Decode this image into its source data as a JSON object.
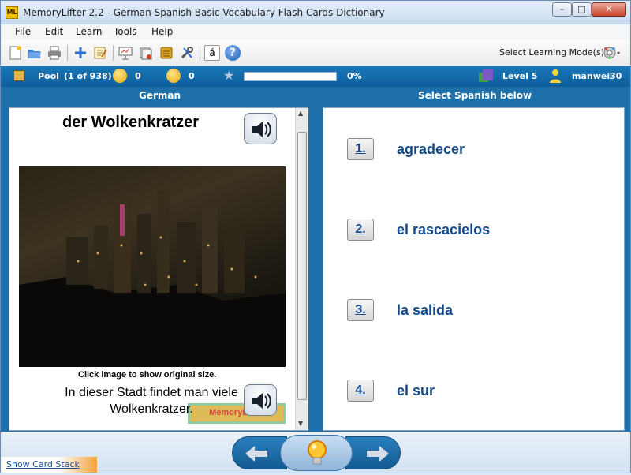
{
  "window": {
    "app_icon_text": "ML",
    "title": "MemoryLifter 2.2 - German Spanish Basic Vocabulary Flash Cards Dictionary",
    "controls": {
      "minimize": "–",
      "maximize": "□",
      "close": "✕"
    }
  },
  "menu": [
    "File",
    "Edit",
    "Learn",
    "Tools",
    "Help"
  ],
  "toolbar": {
    "icons": [
      "new-document-icon",
      "open-folder-icon",
      "print-icon",
      "add-icon",
      "edit-icon",
      "presentation-icon",
      "cards-icon",
      "stack-icon",
      "tools-icon",
      "special-char-icon",
      "help-icon"
    ],
    "special_char_label": "á",
    "help_label": "?",
    "learning_mode_label": "Select Learning Mode(s)"
  },
  "status": {
    "pool_label": "Pool",
    "pool_position": "(1 of 938)",
    "happy_count": "0",
    "sad_count": "0",
    "progress_percent": 0,
    "progress_text": "0%",
    "level_label": "Level 5",
    "user": "manwei30"
  },
  "question_panel": {
    "header": "German",
    "word": "der Wolkenkratzer",
    "image_caption": "Click image to show original size.",
    "example_sentence": "In dieser Stadt findet man viele Wolkenkratzer.",
    "watermark": "MemoryLifter"
  },
  "answer_panel": {
    "header": "Select Spanish below",
    "choices": [
      {
        "number": "1.",
        "text": "agradecer"
      },
      {
        "number": "2.",
        "text": "el rascacielos"
      },
      {
        "number": "3.",
        "text": "la salida"
      },
      {
        "number": "4.",
        "text": "el sur"
      }
    ]
  },
  "navigation": {
    "show_card_stack": "Show Card Stack"
  },
  "colors": {
    "accent_blue": "#1d6faa",
    "status_blue": "#0c5d9a",
    "answer_text": "#164b8a"
  }
}
